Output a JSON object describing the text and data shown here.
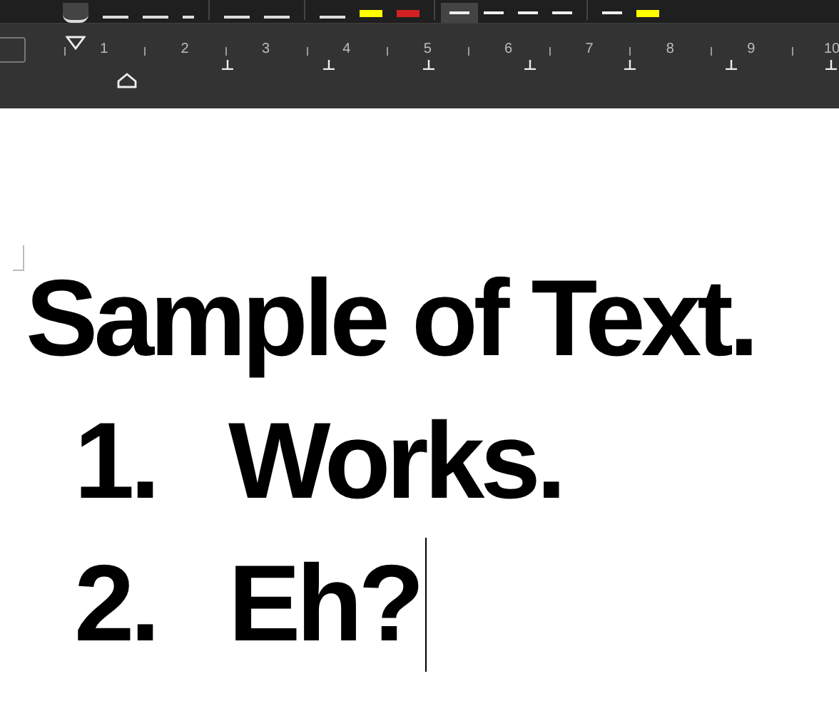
{
  "toolbar": {
    "swatches": [
      {
        "color": "#ffff00"
      },
      {
        "color": "#d42020"
      },
      {
        "color": "#ffff00"
      }
    ]
  },
  "ruler": {
    "numbers": [
      "1",
      "2",
      "3",
      "4",
      "5",
      "6",
      "7",
      "8",
      "9",
      "10"
    ]
  },
  "document": {
    "heading": "Sample of Text.",
    "list": [
      {
        "marker": "1.",
        "text": "Works."
      },
      {
        "marker": "2.",
        "text": "Eh?"
      }
    ]
  }
}
